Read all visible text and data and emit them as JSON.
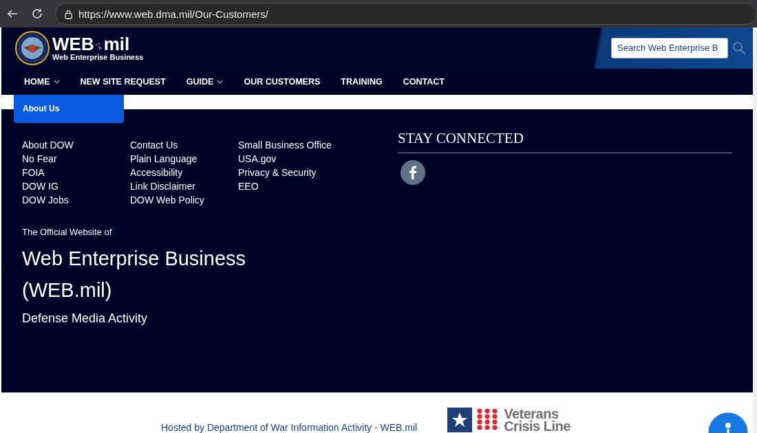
{
  "browser": {
    "url": "https://www.web.dma.mil/Our-Customers/"
  },
  "header": {
    "logo_title": [
      "WEB",
      "mil"
    ],
    "logo_subtitle": "Web Enterprise Business",
    "search": {
      "placeholder": "Search Web Enterprise B"
    }
  },
  "nav": [
    {
      "label": "HOME",
      "dropdown": true
    },
    {
      "label": "NEW SITE REQUEST",
      "dropdown": false
    },
    {
      "label": "GUIDE",
      "dropdown": true
    },
    {
      "label": "OUR CUSTOMERS",
      "dropdown": false
    },
    {
      "label": "TRAINING",
      "dropdown": false
    },
    {
      "label": "CONTACT",
      "dropdown": false
    }
  ],
  "dropdown_menu": [
    "About Us"
  ],
  "footer": {
    "link_columns": [
      [
        "About DOW",
        "No Fear",
        "FOIA",
        "DOW IG",
        "DOW Jobs"
      ],
      [
        "Contact Us",
        "Plain Language",
        "Accessibility",
        "Link Disclaimer",
        "DOW Web Policy"
      ],
      [
        "Small Business Office",
        "USA.gov",
        "Privacy & Security",
        "EEO"
      ]
    ],
    "stay_connected": "STAY CONNECTED",
    "official_label": "The Official Website of",
    "site_name": "Web Enterprise Business (WEB.mil)",
    "agency": "Defense Media Activity"
  },
  "bottom": {
    "hosted_by": "Hosted by Department of War Information Activity - WEB.mil",
    "crisis_line": [
      "Veterans",
      "Crisis Line"
    ]
  }
}
